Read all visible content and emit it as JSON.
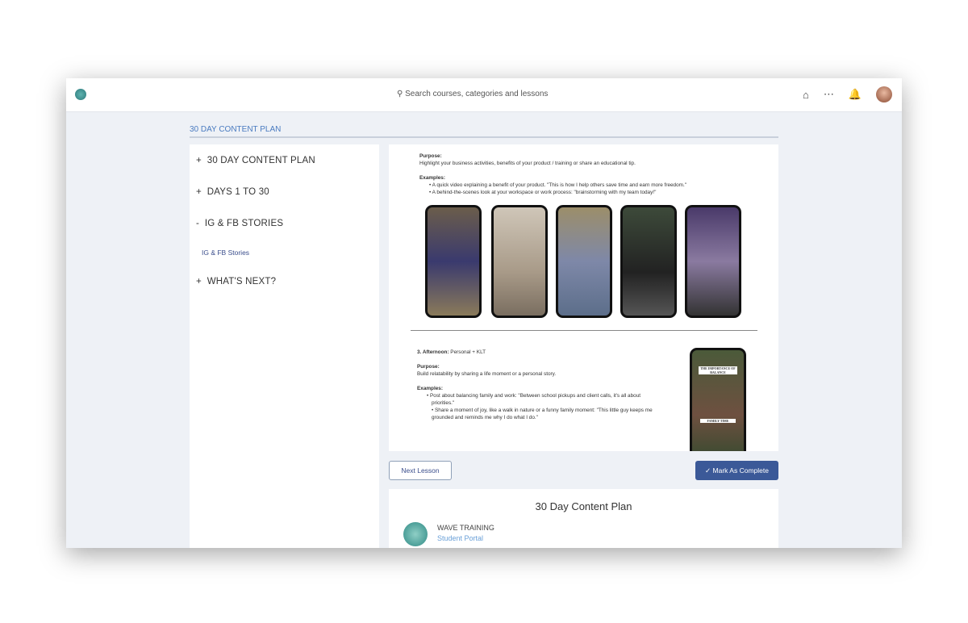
{
  "header": {
    "search_placeholder": "Search courses, categories and lessons"
  },
  "breadcrumb": "30 DAY CONTENT PLAN",
  "sidebar": {
    "items": [
      {
        "prefix": "+",
        "label": "30 DAY CONTENT PLAN"
      },
      {
        "prefix": "+",
        "label": "DAYS 1 TO 30"
      },
      {
        "prefix": "-",
        "label": "IG & FB STORIES"
      },
      {
        "prefix": "+",
        "label": "WHAT'S NEXT?"
      }
    ],
    "sub_item": "IG & FB Stories"
  },
  "lesson": {
    "purpose_label": "Purpose:",
    "purpose1": "Highlight your business activities, benefits of your product / training or share an educational tip.",
    "examples_label": "Examples:",
    "ex1": "A quick video explaining a benefit of your product. \"This is how I help others save time and earn more freedom.\"",
    "ex2": "A behind-the-scenes look at your workspace or work process: \"brainstorming with my team today!\"",
    "afternoon_num": "3. Afternoon:",
    "afternoon_text": " Personal + KLT",
    "purpose2": "Build relatability by sharing a life moment or a personal story.",
    "ex3": "Post about balancing family and work: \"Between school pickups and client calls, it's all about priorities.\"",
    "ex4": "Share a moment of joy, like a walk in nature or a funny family moment: \"This little guy keeps me grounded and reminds me why I do what I do.\"",
    "phone_caption1": "THE IMPORTANCE OF BALANCE",
    "phone_caption2": "FAMILY TIME"
  },
  "buttons": {
    "next": "Next Lesson",
    "complete": "Mark As Complete"
  },
  "course": {
    "title": "30 Day Content Plan",
    "org": "WAVE TRAINING",
    "portal": "Student Portal"
  }
}
